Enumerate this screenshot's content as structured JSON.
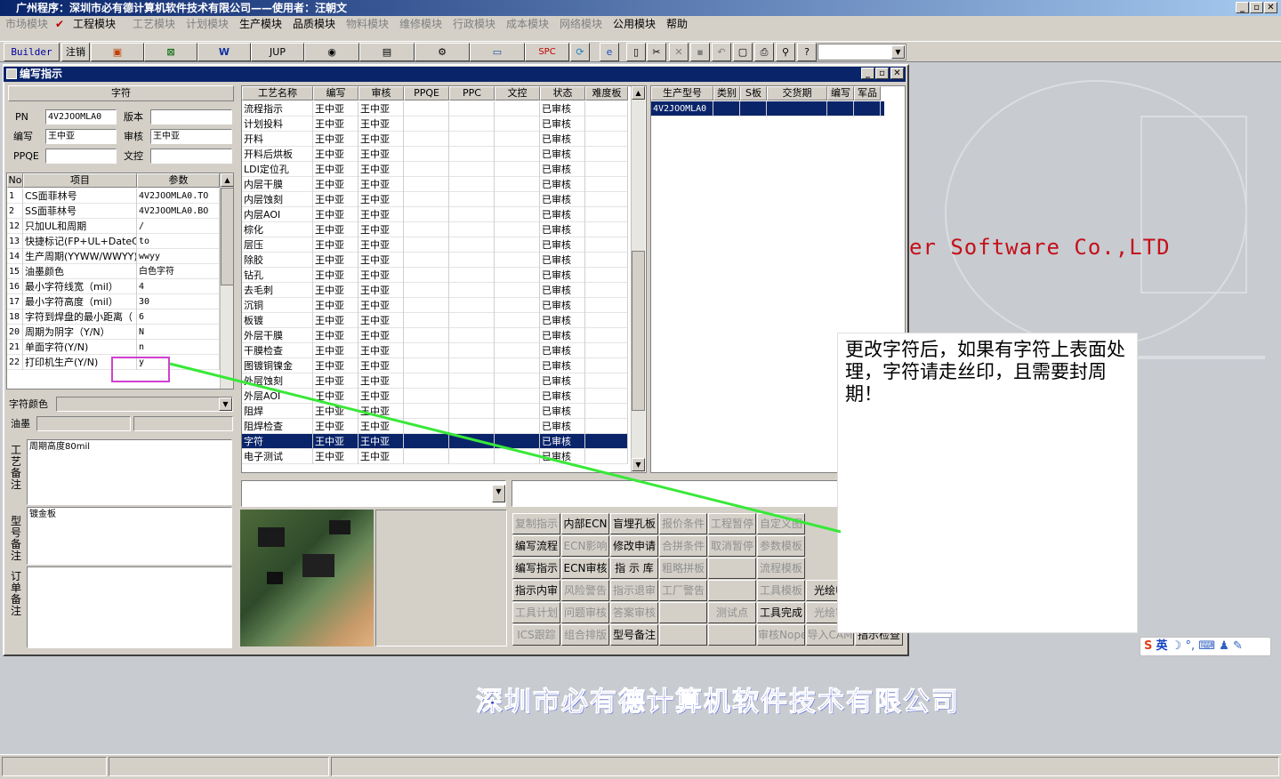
{
  "app": {
    "title": "广州程序：深圳市必有德计算机软件技术有限公司——使用者：汪朝文"
  },
  "window_buttons": [
    "_",
    "▫",
    "✕"
  ],
  "menu": [
    {
      "label": "市场模块",
      "enabled": false
    },
    {
      "label": "工程模块",
      "enabled": true,
      "checked": true
    },
    {
      "label": "工艺模块",
      "enabled": false
    },
    {
      "label": "计划模块",
      "enabled": false
    },
    {
      "label": "生产模块",
      "enabled": true
    },
    {
      "label": "品质模块",
      "enabled": true
    },
    {
      "label": "物料模块",
      "enabled": false
    },
    {
      "label": "维修模块",
      "enabled": false
    },
    {
      "label": "行政模块",
      "enabled": false
    },
    {
      "label": "成本模块",
      "enabled": false
    },
    {
      "label": "网络模块",
      "enabled": false
    },
    {
      "label": "公用模块",
      "enabled": true
    },
    {
      "label": "帮助",
      "enabled": true
    }
  ],
  "toolbar": {
    "builder": "Builder",
    "logout": "注销",
    "jup": "JUP",
    "spc": "SPC",
    "icons": [
      "ppt-icon",
      "excel-icon",
      "word-icon",
      "eye-icon",
      "database-icon",
      "network-icon",
      "computer-icon",
      "spc-icon",
      "refresh-icon",
      "ie-icon",
      "new-icon",
      "cut-icon",
      "delete-icon",
      "save-icon",
      "undo-icon",
      "preview-icon",
      "print-icon",
      "find-icon",
      "help-icon"
    ]
  },
  "inner_window": {
    "title": "编写指示",
    "buttons": [
      "_",
      "▫",
      "✕"
    ]
  },
  "left_panel": {
    "section_title": "字符",
    "pn_label": "PN",
    "pn_value": "4V2JOOMLA0",
    "version_label": "版本",
    "version_value": "",
    "writer_label": "编写",
    "writer_value": "王中亚",
    "review_label": "审核",
    "review_value": "王中亚",
    "ppqe_label": "PPQE",
    "ppqe_value": "",
    "doc_label": "文控",
    "doc_value": "",
    "param_headers": [
      "No",
      "项目",
      "参数"
    ],
    "params": [
      {
        "no": "1",
        "item": "CS面菲林号",
        "value": "4V2JOOMLA0.TO"
      },
      {
        "no": "2",
        "item": "SS面菲林号",
        "value": "4V2JOOMLA0.BO"
      },
      {
        "no": "12",
        "item": "只加UL和周期",
        "value": "/"
      },
      {
        "no": "13",
        "item": "快捷标记(FP+UL+DateCo",
        "value": "to"
      },
      {
        "no": "14",
        "item": "生产周期(YYWW/WWYY)",
        "value": "wwyy"
      },
      {
        "no": "15",
        "item": "油墨颜色",
        "value": "白色字符"
      },
      {
        "no": "16",
        "item": "最小字符线宽（mil）",
        "value": "4"
      },
      {
        "no": "17",
        "item": "最小字符高度（mil）",
        "value": "30"
      },
      {
        "no": "18",
        "item": "字符到焊盘的最小距离（",
        "value": "6"
      },
      {
        "no": "20",
        "item": "周期为阴字（Y/N）",
        "value": "N"
      },
      {
        "no": "21",
        "item": "单面字符(Y/N)",
        "value": "n"
      },
      {
        "no": "22",
        "item": "打印机生产(Y/N)",
        "value": "y"
      }
    ],
    "color_label": "字符颜色",
    "color_value": "",
    "ink_label": "油墨",
    "process_note_label": "工艺备注",
    "process_note": "周期高度80mil",
    "model_note_label": "型号备注",
    "model_note": "镀金板",
    "order_note_label": "订单备注",
    "order_note": ""
  },
  "process_table": {
    "headers": [
      "工艺名称",
      "编写",
      "审核",
      "PPQE",
      "PPC",
      "文控",
      "状态",
      "难度板"
    ],
    "rows": [
      [
        "流程指示",
        "王中亚",
        "王中亚",
        "",
        "",
        "",
        "已审核",
        ""
      ],
      [
        "计划投料",
        "王中亚",
        "王中亚",
        "",
        "",
        "",
        "已审核",
        ""
      ],
      [
        "开料",
        "王中亚",
        "王中亚",
        "",
        "",
        "",
        "已审核",
        ""
      ],
      [
        "开料后烘板",
        "王中亚",
        "王中亚",
        "",
        "",
        "",
        "已审核",
        ""
      ],
      [
        "LDI定位孔",
        "王中亚",
        "王中亚",
        "",
        "",
        "",
        "已审核",
        ""
      ],
      [
        "内层干膜",
        "王中亚",
        "王中亚",
        "",
        "",
        "",
        "已审核",
        ""
      ],
      [
        "内层蚀刻",
        "王中亚",
        "王中亚",
        "",
        "",
        "",
        "已审核",
        ""
      ],
      [
        "内层AOI",
        "王中亚",
        "王中亚",
        "",
        "",
        "",
        "已审核",
        ""
      ],
      [
        "棕化",
        "王中亚",
        "王中亚",
        "",
        "",
        "",
        "已审核",
        ""
      ],
      [
        "层压",
        "王中亚",
        "王中亚",
        "",
        "",
        "",
        "已审核",
        ""
      ],
      [
        "除胶",
        "王中亚",
        "王中亚",
        "",
        "",
        "",
        "已审核",
        ""
      ],
      [
        "钻孔",
        "王中亚",
        "王中亚",
        "",
        "",
        "",
        "已审核",
        ""
      ],
      [
        "去毛刺",
        "王中亚",
        "王中亚",
        "",
        "",
        "",
        "已审核",
        ""
      ],
      [
        "沉铜",
        "王中亚",
        "王中亚",
        "",
        "",
        "",
        "已审核",
        ""
      ],
      [
        "板镀",
        "王中亚",
        "王中亚",
        "",
        "",
        "",
        "已审核",
        ""
      ],
      [
        "外层干膜",
        "王中亚",
        "王中亚",
        "",
        "",
        "",
        "已审核",
        ""
      ],
      [
        "干膜检查",
        "王中亚",
        "王中亚",
        "",
        "",
        "",
        "已审核",
        ""
      ],
      [
        "图镀铜镍金",
        "王中亚",
        "王中亚",
        "",
        "",
        "",
        "已审核",
        ""
      ],
      [
        "外层蚀刻",
        "王中亚",
        "王中亚",
        "",
        "",
        "",
        "已审核",
        ""
      ],
      [
        "外层AOI",
        "王中亚",
        "王中亚",
        "",
        "",
        "",
        "已审核",
        ""
      ],
      [
        "阻焊",
        "王中亚",
        "王中亚",
        "",
        "",
        "",
        "已审核",
        ""
      ],
      [
        "阻焊检查",
        "王中亚",
        "王中亚",
        "",
        "",
        "",
        "已审核",
        ""
      ],
      [
        "字符",
        "王中亚",
        "王中亚",
        "",
        "",
        "",
        "已审核",
        ""
      ],
      [
        "电子测试",
        "王中亚",
        "王中亚",
        "",
        "",
        "",
        "已审核",
        ""
      ]
    ],
    "selected_index": 22
  },
  "model_table": {
    "headers": [
      "生产型号",
      "类别",
      "S板",
      "交货期",
      "编写",
      "军品"
    ],
    "rows": [
      [
        "4V2JOOMLA0",
        "",
        "",
        "",
        "",
        ""
      ]
    ]
  },
  "buttons": [
    [
      {
        "label": "复制指示",
        "enabled": false
      },
      {
        "label": "内部ECN",
        "enabled": true
      },
      {
        "label": "盲埋孔板",
        "enabled": true
      },
      {
        "label": "报价条件",
        "enabled": false
      },
      {
        "label": "工程暂停",
        "enabled": false
      },
      {
        "label": "自定义图",
        "enabled": false
      }
    ],
    [
      {
        "label": "编写流程",
        "enabled": true
      },
      {
        "label": "ECN影响",
        "enabled": false
      },
      {
        "label": "修改申请",
        "enabled": true
      },
      {
        "label": "合拼条件",
        "enabled": false
      },
      {
        "label": "取消暂停",
        "enabled": false
      },
      {
        "label": "参数模板",
        "enabled": false
      }
    ],
    [
      {
        "label": "编写指示",
        "enabled": true
      },
      {
        "label": "ECN审核",
        "enabled": true
      },
      {
        "label": "指 示 库",
        "enabled": true
      },
      {
        "label": "粗略拼板",
        "enabled": false
      },
      {
        "label": "",
        "enabled": false
      },
      {
        "label": "流程模板",
        "enabled": false
      }
    ],
    [
      {
        "label": "指示内审",
        "enabled": true
      },
      {
        "label": "风险警告",
        "enabled": false
      },
      {
        "label": "指示退审",
        "enabled": false
      },
      {
        "label": "工厂警告",
        "enabled": false
      },
      {
        "label": "",
        "enabled": false
      },
      {
        "label": "工具模板",
        "enabled": false
      },
      {
        "label": "光绘申",
        "enabled": true
      }
    ],
    [
      {
        "label": "工具计划",
        "enabled": false
      },
      {
        "label": "问题审核",
        "enabled": false
      },
      {
        "label": "答案审核",
        "enabled": false
      },
      {
        "label": "",
        "enabled": false
      },
      {
        "label": "测试点",
        "enabled": false
      },
      {
        "label": "工具完成",
        "enabled": true
      },
      {
        "label": "光绘审",
        "enabled": false
      }
    ],
    [
      {
        "label": "ICS跟踪",
        "enabled": false
      },
      {
        "label": "组合排版",
        "enabled": false
      },
      {
        "label": "型号备注",
        "enabled": true
      },
      {
        "label": "",
        "enabled": false
      },
      {
        "label": "",
        "enabled": false
      },
      {
        "label": "审核Nope",
        "enabled": false
      },
      {
        "label": "导入CAM",
        "enabled": false
      },
      {
        "label": "指示检查",
        "enabled": true
      }
    ]
  ],
  "annotation": {
    "text": "更改字符后，如果有字符上表面处理，字符请走丝印，且需要封周期！"
  },
  "background": {
    "company_cn": "深圳市必有德计算机软件技术有限公司",
    "company_en_partial": "er Software Co.,LTD"
  },
  "ime": {
    "label": "英"
  }
}
